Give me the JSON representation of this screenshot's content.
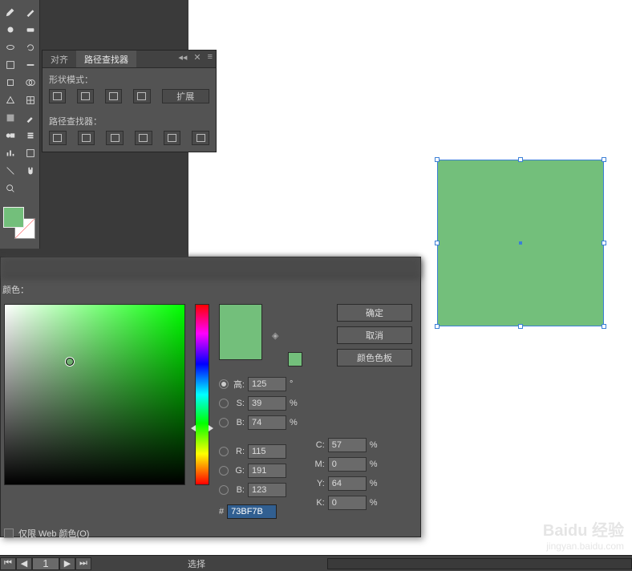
{
  "pathfinder": {
    "tab_align": "对齐",
    "tab_pathfinder": "路径查找器",
    "section_shape_modes": "形状模式：",
    "expand_btn": "扩展",
    "section_pathfinders": "路径查找器："
  },
  "shape": {
    "fill_color": "#73BF7B"
  },
  "color_picker": {
    "title": "颜色：",
    "ok": "确定",
    "cancel": "取消",
    "swatches": "颜色色板",
    "fields": {
      "H": {
        "label": "高:",
        "value": "125",
        "suffix": "°"
      },
      "S": {
        "label": "S:",
        "value": "39",
        "suffix": "%"
      },
      "Bv": {
        "label": "B:",
        "value": "74",
        "suffix": "%"
      },
      "R": {
        "label": "R:",
        "value": "115"
      },
      "G": {
        "label": "G:",
        "value": "191"
      },
      "B": {
        "label": "B:",
        "value": "123"
      },
      "C": {
        "label": "C:",
        "value": "57",
        "suffix": "%"
      },
      "M": {
        "label": "M:",
        "value": "0",
        "suffix": "%"
      },
      "Y": {
        "label": "Y:",
        "value": "64",
        "suffix": "%"
      },
      "K": {
        "label": "K:",
        "value": "0",
        "suffix": "%"
      }
    },
    "hex_prefix": "#",
    "hex": "73BF7B",
    "web_only": "仅限 Web 颜色(O)"
  },
  "bottom": {
    "page": "1",
    "status": "选择"
  },
  "watermark": {
    "brand": "Baidu 经验",
    "url": "jingyan.baidu.com"
  }
}
